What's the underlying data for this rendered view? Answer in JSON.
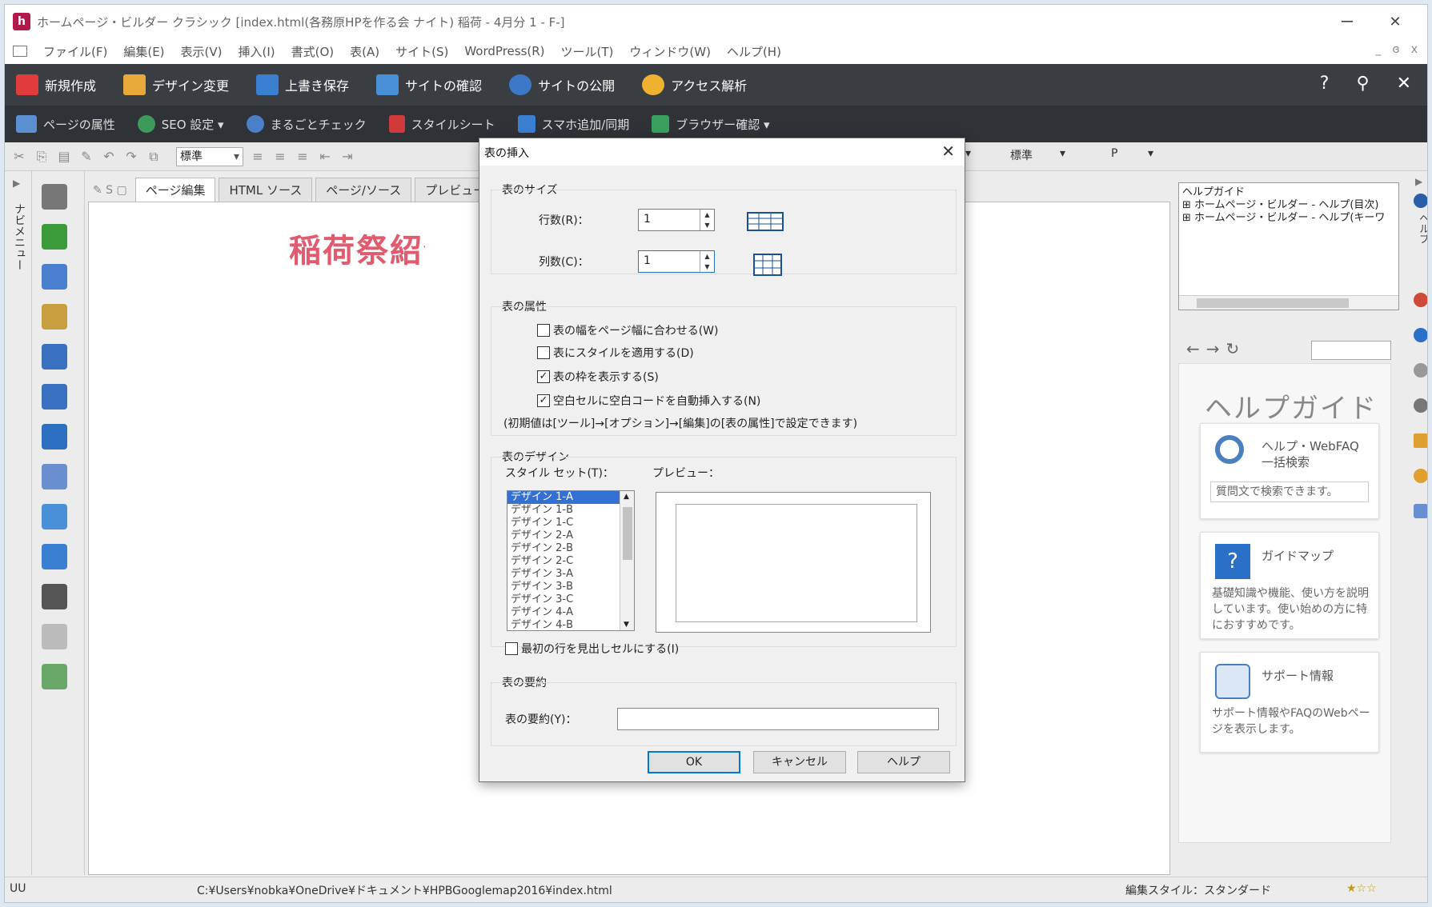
{
  "window": {
    "title": "ホームページ・ビルダー クラシック [index.html(各務原HPを作る会 ナイト) 稲荷 - 4月分 1 - F-]",
    "min": "ー",
    "close": "✕"
  },
  "menubar": {
    "items": [
      "ファイル(F)",
      "編集(E)",
      "表示(V)",
      "挿入(I)",
      "書式(O)",
      "表(A)",
      "サイト(S)",
      "WordPress(R)",
      "ツール(T)",
      "ウィンドウ(W)",
      "ヘルプ(H)"
    ],
    "mdi": [
      "_",
      "ɞ",
      "x"
    ]
  },
  "toolbar1": {
    "items": [
      "新規作成",
      "デザイン変更",
      "上書き保存",
      "サイトの確認",
      "サイトの公開",
      "アクセス解析"
    ],
    "colors": [
      "#e03c3c",
      "#e6a93a",
      "#3a7fd0",
      "#4a90d9",
      "#3b78c8",
      "#f0b030"
    ]
  },
  "toolbar2": {
    "items": [
      "ページの属性",
      "SEO 設定 ▾",
      "まるごとチェック",
      "スタイルシート",
      "スマホ追加/同期",
      "ブラウザー確認 ▾"
    ]
  },
  "toolbar3": {
    "style_value": "標準",
    "dd_font": "標準",
    "dd_p": "P"
  },
  "leftnav": {
    "label": "ナビメニュー",
    "tool_colors": [
      "#777",
      "#3b9b3b",
      "#4a7fd0",
      "#c8a040",
      "#3a70c0",
      "#3a70c0",
      "#2d6fc0",
      "#6a8fd0",
      "#4a90d9",
      "#3a7fd0",
      "#555",
      "#bbb",
      "#6aa86a"
    ],
    "tool_icons": [
      "text-tool-icon",
      "image-tool-icon",
      "photo-tool-icon",
      "clip-tool-icon",
      "movie-tool-icon",
      "gallery-tool-icon",
      "parts-tool-icon",
      "form-tool-icon",
      "table-tool-icon",
      "list-tool-icon",
      "mobile-tool-icon",
      "page-tool-icon",
      "layout-tool-icon"
    ]
  },
  "editor": {
    "tabs": [
      "ページ編集",
      "HTML ソース",
      "ページ/ソース",
      "プレビュー"
    ],
    "heading": "稲荷祭紹介"
  },
  "help": {
    "tree": [
      "ヘルプガイド",
      "⊞ ホームページ・ビルダー - ヘルプ(目次)",
      "⊞ ホームページ・ビルダー - ヘルプ(キーワ"
    ],
    "title": "ヘルプガイド",
    "cards": [
      {
        "title": "ヘルプ・WebFAQ 一括検索",
        "desc": "質問文で検索できます。"
      },
      {
        "title": "ガイドマップ",
        "desc": "基礎知識や機能、使い方を説明しています。使い始めの方に特におすすめです。"
      },
      {
        "title": "サポート情報",
        "desc": "サポート情報やFAQのWebページを表示します。"
      }
    ],
    "vertical_label": "ヘルプ"
  },
  "statusbar": {
    "left": "UU",
    "path": "C:¥Users¥nobka¥OneDrive¥ドキュメント¥HPBGooglemap2016¥index.html",
    "style": "編集スタイル：スタンダード",
    "rating": "★☆☆"
  },
  "dialog": {
    "title": "表の挿入",
    "size_group": "表のサイズ",
    "rows_label": "行数(R)：",
    "rows_value": "1",
    "cols_label": "列数(C)：",
    "cols_value": "1",
    "attr_group": "表の属性",
    "checks": [
      {
        "label": "表の幅をページ幅に合わせる(W)",
        "checked": false
      },
      {
        "label": "表にスタイルを適用する(D)",
        "checked": false
      },
      {
        "label": "表の枠を表示する(S)",
        "checked": true
      },
      {
        "label": "空白セルに空白コードを自動挿入する(N)",
        "checked": true
      }
    ],
    "note": "(初期値は[ツール]→[オプション]→[編集]の[表の属性]で設定できます)",
    "design_group": "表のデザイン",
    "style_set_label": "スタイル セット(T)：",
    "preview_label": "プレビュー：",
    "styles": [
      "デザイン 1-A",
      "デザイン 1-B",
      "デザイン 1-C",
      "デザイン 2-A",
      "デザイン 2-B",
      "デザイン 2-C",
      "デザイン 3-A",
      "デザイン 3-B",
      "デザイン 3-C",
      "デザイン 4-A",
      "デザイン 4-B"
    ],
    "header_check": "最初の行を見出しセルにする(I)",
    "summary_group": "表の要約",
    "summary_label": "表の要約(Y)：",
    "buttons": {
      "ok": "OK",
      "cancel": "キャンセル",
      "help": "ヘルプ"
    }
  }
}
